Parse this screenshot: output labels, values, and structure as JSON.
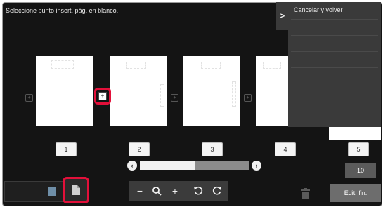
{
  "window": {
    "instruction": "Seleccione punto insert. pág. en blanco."
  },
  "pages": [
    {
      "number": "1"
    },
    {
      "number": "2"
    },
    {
      "number": "3"
    },
    {
      "number": "4"
    },
    {
      "number": "5"
    }
  ],
  "total_pages": "10",
  "side_panel": {
    "toggle_icon": "chevron-right-icon",
    "cancel_label": "Cancelar y volver"
  },
  "toolbar": {
    "zoom_out": "−",
    "zoom_in": "+",
    "zoom_icon": "magnifier-icon",
    "rotate_left_icon": "rotate-left-icon",
    "rotate_right_icon": "rotate-right-icon"
  },
  "actions": {
    "finish_label": "Edit. fin.",
    "delete_icon": "trash-icon",
    "blank_page_icon": "blank-page-icon"
  },
  "colors": {
    "highlight": "#e3103a",
    "background": "#141414",
    "panel": "#3a3a3a"
  }
}
